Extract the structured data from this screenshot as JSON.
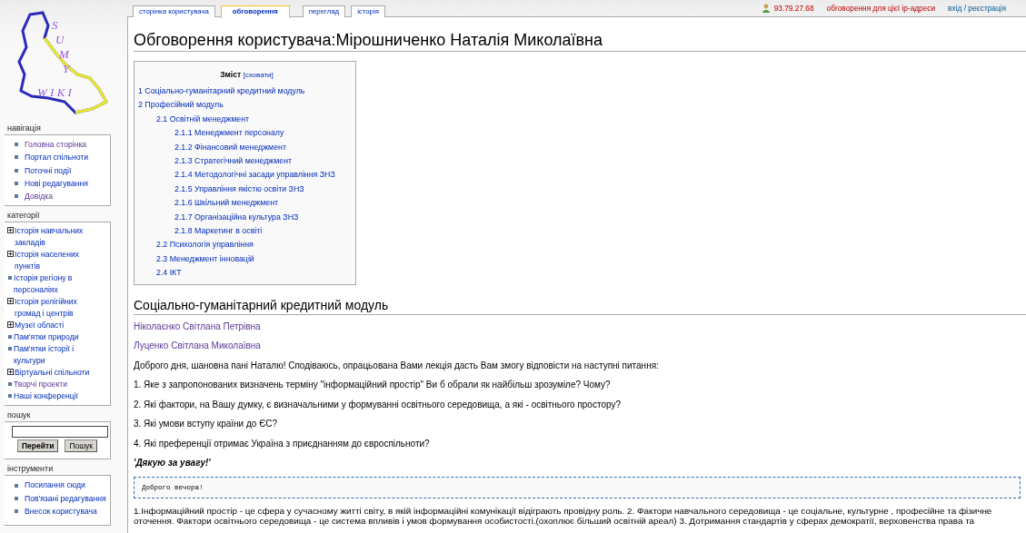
{
  "logo": {
    "letters": [
      "S",
      "U",
      "M",
      "Y"
    ],
    "word": "W I K I"
  },
  "personal": [
    {
      "label": "93.79.27.68",
      "missing": true,
      "kind": "user"
    },
    {
      "label": "обговорення для цієї ip-адреси",
      "missing": true,
      "kind": "link"
    },
    {
      "label": "вхід / реєстрація",
      "missing": false,
      "kind": "link"
    }
  ],
  "tabs": [
    {
      "label": "сторінка користувача",
      "selected": false
    },
    {
      "label": "обговорення",
      "selected": true
    },
    {
      "label": "переглад",
      "selected": false
    },
    {
      "label": "історія",
      "selected": false
    }
  ],
  "sidebar": {
    "navigation": {
      "title": "навігація",
      "items": [
        {
          "label": "Головна сторінка",
          "visited": true
        },
        {
          "label": "Портал спільноти",
          "visited": false
        },
        {
          "label": "Поточні події",
          "visited": false
        },
        {
          "label": "Нові редагування",
          "visited": false
        },
        {
          "label": "Довідка",
          "visited": true
        }
      ]
    },
    "categories": {
      "title": "категорії",
      "items": [
        {
          "label": "Історія навчальних закладів",
          "kind": "tree",
          "expanded": false,
          "visited": false
        },
        {
          "label": "Історія населених пунктів",
          "kind": "tree",
          "expanded": false,
          "visited": false
        },
        {
          "label": "Історія регіону в персоналіях",
          "kind": "leaf",
          "visited": false
        },
        {
          "label": "Історія релігійних громад і центрів",
          "kind": "tree",
          "expanded": false,
          "visited": false
        },
        {
          "label": "Музеї області",
          "kind": "tree",
          "expanded": false,
          "visited": false
        },
        {
          "label": "Пам'ятки природи",
          "kind": "leaf",
          "visited": false
        },
        {
          "label": "Пам'ятки історії і культури",
          "kind": "leaf",
          "visited": false
        },
        {
          "label": "Віртуальні спільноти",
          "kind": "tree",
          "expanded": false,
          "visited": false
        },
        {
          "label": "Творчі проекти",
          "kind": "leaf",
          "visited": true
        },
        {
          "label": "Наші конференції",
          "kind": "leaf",
          "visited": false
        }
      ]
    },
    "search": {
      "title": "пошук",
      "buttons": [
        {
          "label": "Перейти",
          "primary": true
        },
        {
          "label": "Пошук",
          "primary": false
        }
      ]
    },
    "tools": {
      "title": "інструменти",
      "items": [
        {
          "label": "Посилання сюди",
          "visited": false
        },
        {
          "label": "Пов'язані редагування",
          "visited": false
        },
        {
          "label": "Внесок користувача",
          "visited": false
        }
      ]
    }
  },
  "page": {
    "title": "Обговорення користувача:Мірошниченко Наталія Миколаївна",
    "toc": {
      "title": "Зміст",
      "toggle": "[сховати]",
      "items": [
        {
          "label": "1 Соціально-гуманітарний кредитний модуль"
        },
        {
          "label": "2 Професійний модуль",
          "children": [
            {
              "label": "2.1 Освітній менеджмент",
              "children": [
                {
                  "label": "2.1.1 Менеджмент персоналу"
                },
                {
                  "label": "2.1.2 Фінансовий менеджмент"
                },
                {
                  "label": "2.1.3 Стратегічний менеджмент"
                },
                {
                  "label": "2.1.4 Методологічні засади управління ЗНЗ"
                },
                {
                  "label": "2.1.5 Управління якістю освіти ЗНЗ"
                },
                {
                  "label": "2.1.6 Шкільний менеджмент"
                },
                {
                  "label": "2.1.7 Організаційна культура ЗНЗ"
                },
                {
                  "label": "2.1.8 Маркетинг в освіті"
                }
              ]
            },
            {
              "label": "2.2 Психологія управління"
            },
            {
              "label": "2.3 Менеджмент інновацій"
            },
            {
              "label": "2.4 ІКТ"
            }
          ]
        }
      ]
    },
    "section": {
      "heading": "Соціально-гуманітарний кредитний модуль",
      "blocks": [
        {
          "kind": "link",
          "text": "Ніколаєнко Світлана Петрівна"
        },
        {
          "kind": "link",
          "text": "Луценко Світлана Миколаївна"
        },
        {
          "kind": "text",
          "text": "Доброго дня, шановна пані Наталю! Сподіваюсь, опрацьована Вами лекція дасть Вам змогу відповісти на наступні питання:"
        },
        {
          "kind": "text",
          "text": "1. Яке з запропонованих визначень терміну \"інформаційний простір\" Ви б обрали як найбільш зрозуміле? Чому?"
        },
        {
          "kind": "text",
          "text": "2. Які фактори, на Вашу думку, є визначальними у формуванні освітнього середовища, а які - освітнього простору?"
        },
        {
          "kind": "text",
          "text": "3. Які умови вступу країни до ЄС?"
        },
        {
          "kind": "text",
          "text": "4. Які преференції отримає Україна з приєднанням до євроспільноти?"
        },
        {
          "kind": "emphasis",
          "text": "'Дякую за увагу!'"
        },
        {
          "kind": "pre",
          "text": "Доброго вечора!"
        },
        {
          "kind": "lines",
          "lines": [
            "1.Інформаційний простір - це сфера у сучасному житті світу, в якій інформаційні комунікації відіграють провідну роль. 2. Фактори навчального середовища - це соціальне, культурне , професійне та фізичне",
            "оточення. Фактори освітнього середовища - це система впливів і умов формування особистості.(охоплює більший освітній ареал) 3. Дотримання стандартів у сферах демократії, верховенства права та"
          ]
        }
      ]
    }
  }
}
